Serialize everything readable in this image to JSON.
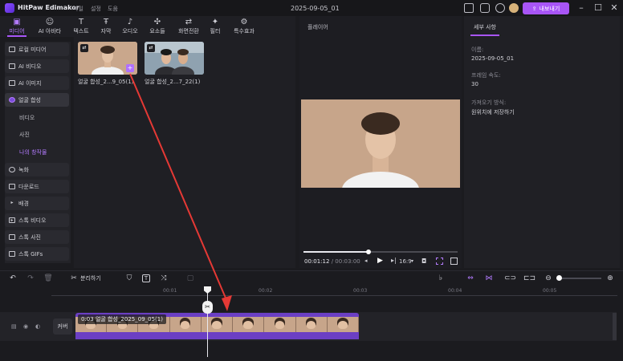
{
  "app": {
    "name": "HitPaw Edimakor",
    "menus": [
      "파일",
      "설정",
      "도움"
    ],
    "document_title": "2025-09-05_01",
    "export_label": "내보내기"
  },
  "toolbar": [
    {
      "icon": "media-icon",
      "label": "미디어",
      "active": true
    },
    {
      "icon": "ai-avatar-icon",
      "label": "AI 아바타"
    },
    {
      "icon": "text-icon",
      "label": "텍스트"
    },
    {
      "icon": "subtitle-icon",
      "label": "자막"
    },
    {
      "icon": "audio-icon",
      "label": "오디오"
    },
    {
      "icon": "elements-icon",
      "label": "요소들"
    },
    {
      "icon": "transition-icon",
      "label": "화면전환"
    },
    {
      "icon": "filter-icon",
      "label": "필터"
    },
    {
      "icon": "effects-icon",
      "label": "특수효과"
    }
  ],
  "sidebar": {
    "items": [
      {
        "label": "로컬 미디어"
      },
      {
        "label": "AI 비디오"
      },
      {
        "label": "AI 이미지"
      },
      {
        "label": "얼굴 합성",
        "selected": true
      }
    ],
    "subitems": [
      {
        "label": "비디오"
      },
      {
        "label": "사진"
      },
      {
        "label": "나의 창작물",
        "active": true
      }
    ],
    "items2": [
      {
        "label": "녹화"
      },
      {
        "label": "다운로드"
      },
      {
        "label": "배경"
      },
      {
        "label": "스톡 비디오"
      },
      {
        "label": "스톡 사진"
      },
      {
        "label": "스톡 GIFs"
      }
    ]
  },
  "media": {
    "items": [
      {
        "label": "얼굴 합성_2...9_05(1)"
      },
      {
        "label": "얼굴 합성_2...7_22(1)"
      }
    ]
  },
  "player": {
    "title": "플레이어",
    "current_time": "00:01:12",
    "separator": "/",
    "total_time": "00:03:00",
    "aspect": "16:9",
    "progress": 0.42
  },
  "details": {
    "tab": "세부 사항",
    "fields": [
      {
        "label": "이름:",
        "value": "2025-09-05_01"
      },
      {
        "label": "프레임 속도:",
        "value": "30"
      },
      {
        "label": "가져오기 방식:",
        "value": "원위치에 저장하기"
      }
    ]
  },
  "timeline": {
    "split_label": "분리하기",
    "ticks": [
      "00:01",
      "00:02",
      "00:03",
      "00:04",
      "00:05"
    ],
    "cover_label": "커버",
    "clip_label": "0:03 얼굴 합성_2025_09_05(1)",
    "zoom": 0.05
  },
  "colors": {
    "accent": "#a855f7",
    "arrow": "#e53935"
  }
}
